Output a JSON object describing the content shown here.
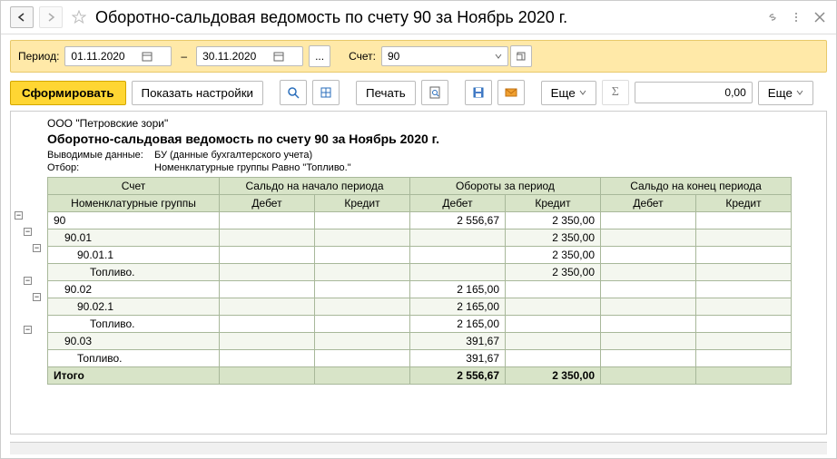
{
  "title": "Оборотно-сальдовая ведомость по счету 90 за Ноябрь 2020 г.",
  "params": {
    "period_label": "Период:",
    "date_from": "01.11.2020",
    "date_to": "30.11.2020",
    "account_label": "Счет:",
    "account_value": "90"
  },
  "toolbar": {
    "generate": "Сформировать",
    "show_settings": "Показать настройки",
    "print": "Печать",
    "more": "Еще",
    "more2": "Еще",
    "value": "0,00"
  },
  "report": {
    "company": "ООО \"Петровские зори\"",
    "title": "Оборотно-сальдовая ведомость по счету 90 за Ноябрь 2020 г.",
    "meta_data_label": "Выводимые данные:",
    "meta_data_value": "БУ (данные бухгалтерского учета)",
    "filter_label": "Отбор:",
    "filter_value": "Номенклатурные группы Равно \"Топливо.\"",
    "headers": {
      "account": "Счет",
      "nomenclature": "Номенклатурные группы",
      "begin": "Сальдо на начало периода",
      "turnover": "Обороты за период",
      "end": "Сальдо на конец периода",
      "debit": "Дебет",
      "credit": "Кредит"
    },
    "rows": [
      {
        "acc": "90",
        "indent": 0,
        "td": "2 556,67",
        "tc": "2 350,00"
      },
      {
        "acc": "90.01",
        "indent": 1,
        "tc": "2 350,00"
      },
      {
        "acc": "90.01.1",
        "indent": 2,
        "tc": "2 350,00"
      },
      {
        "acc": "Топливо.",
        "indent": 3,
        "tc": "2 350,00"
      },
      {
        "acc": "90.02",
        "indent": 1,
        "td": "2 165,00"
      },
      {
        "acc": "90.02.1",
        "indent": 2,
        "td": "2 165,00"
      },
      {
        "acc": "Топливо.",
        "indent": 3,
        "td": "2 165,00"
      },
      {
        "acc": "90.03",
        "indent": 1,
        "td": "391,67"
      },
      {
        "acc": "Топливо.",
        "indent": 2,
        "td": "391,67"
      }
    ],
    "total": {
      "label": "Итого",
      "td": "2 556,67",
      "tc": "2 350,00"
    }
  }
}
